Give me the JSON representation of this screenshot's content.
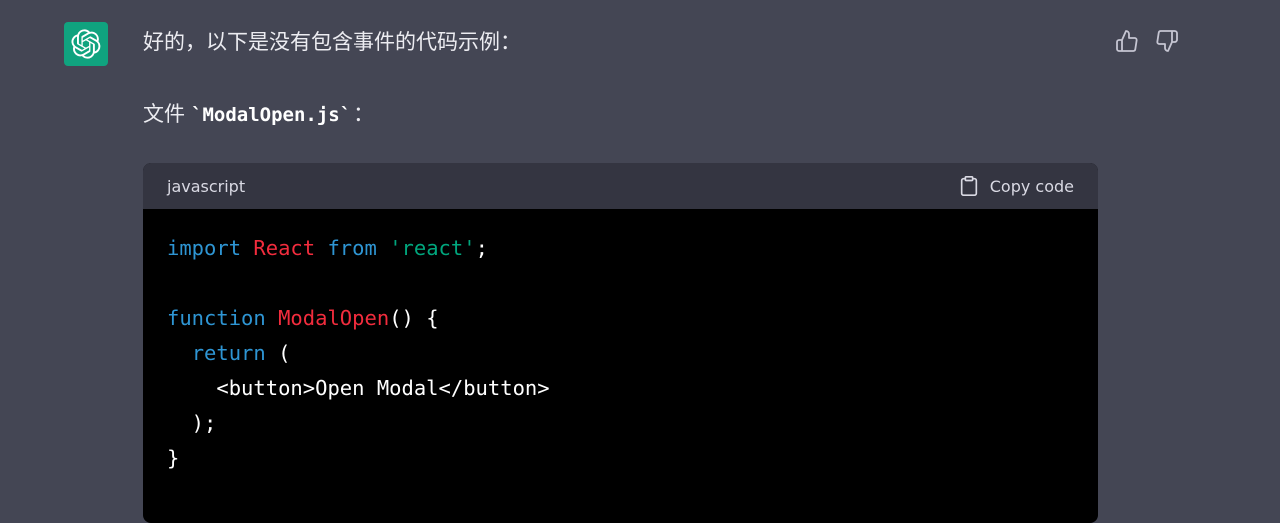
{
  "message": {
    "intro": "好的，以下是没有包含事件的代码示例：",
    "file_prefix": "文件 ",
    "file_name": "`ModalOpen.js`",
    "file_suffix": "："
  },
  "code_block": {
    "language": "javascript",
    "copy_label": "Copy code",
    "lines": [
      [
        [
          "kw",
          "import"
        ],
        [
          "plain",
          " "
        ],
        [
          "cls",
          "React"
        ],
        [
          "plain",
          " "
        ],
        [
          "kw",
          "from"
        ],
        [
          "plain",
          " "
        ],
        [
          "str",
          "'react'"
        ],
        [
          "plain",
          ";"
        ]
      ],
      [],
      [
        [
          "kw",
          "function"
        ],
        [
          "plain",
          " "
        ],
        [
          "fn",
          "ModalOpen"
        ],
        [
          "plain",
          "() {"
        ]
      ],
      [
        [
          "plain",
          "  "
        ],
        [
          "kw",
          "return"
        ],
        [
          "plain",
          " ("
        ]
      ],
      [
        [
          "plain",
          "    <button>Open Modal</button>"
        ]
      ],
      [
        [
          "plain",
          "  );"
        ]
      ],
      [
        [
          "plain",
          "}"
        ]
      ]
    ]
  },
  "icons": {
    "avatar": "openai-logo-icon",
    "thumbs_up": "thumbs-up-icon",
    "thumbs_down": "thumbs-down-icon",
    "copy": "clipboard-icon"
  },
  "colors": {
    "page_bg": "#444654",
    "avatar_bg": "#10a37f",
    "code_header_bg": "#343541",
    "code_bg": "#000000",
    "keyword": "#2e95d3",
    "class_name": "#f22c3d",
    "string": "#00a67d"
  }
}
